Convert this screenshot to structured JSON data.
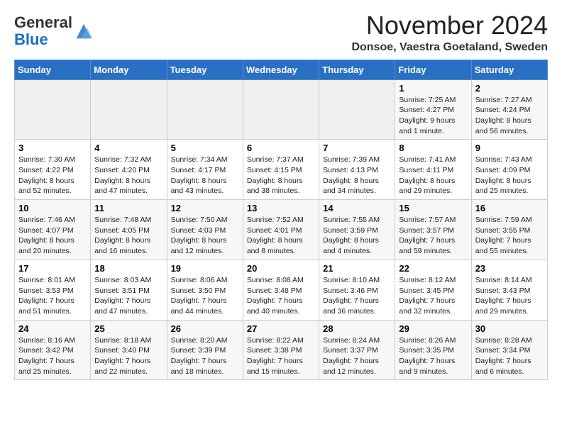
{
  "logo": {
    "general": "General",
    "blue": "Blue"
  },
  "header": {
    "month": "November 2024",
    "location": "Donsoe, Vaestra Goetaland, Sweden"
  },
  "weekdays": [
    "Sunday",
    "Monday",
    "Tuesday",
    "Wednesday",
    "Thursday",
    "Friday",
    "Saturday"
  ],
  "weeks": [
    [
      {
        "day": "",
        "info": ""
      },
      {
        "day": "",
        "info": ""
      },
      {
        "day": "",
        "info": ""
      },
      {
        "day": "",
        "info": ""
      },
      {
        "day": "",
        "info": ""
      },
      {
        "day": "1",
        "info": "Sunrise: 7:25 AM\nSunset: 4:27 PM\nDaylight: 9 hours and 1 minute."
      },
      {
        "day": "2",
        "info": "Sunrise: 7:27 AM\nSunset: 4:24 PM\nDaylight: 8 hours and 56 minutes."
      }
    ],
    [
      {
        "day": "3",
        "info": "Sunrise: 7:30 AM\nSunset: 4:22 PM\nDaylight: 8 hours and 52 minutes."
      },
      {
        "day": "4",
        "info": "Sunrise: 7:32 AM\nSunset: 4:20 PM\nDaylight: 8 hours and 47 minutes."
      },
      {
        "day": "5",
        "info": "Sunrise: 7:34 AM\nSunset: 4:17 PM\nDaylight: 8 hours and 43 minutes."
      },
      {
        "day": "6",
        "info": "Sunrise: 7:37 AM\nSunset: 4:15 PM\nDaylight: 8 hours and 38 minutes."
      },
      {
        "day": "7",
        "info": "Sunrise: 7:39 AM\nSunset: 4:13 PM\nDaylight: 8 hours and 34 minutes."
      },
      {
        "day": "8",
        "info": "Sunrise: 7:41 AM\nSunset: 4:11 PM\nDaylight: 8 hours and 29 minutes."
      },
      {
        "day": "9",
        "info": "Sunrise: 7:43 AM\nSunset: 4:09 PM\nDaylight: 8 hours and 25 minutes."
      }
    ],
    [
      {
        "day": "10",
        "info": "Sunrise: 7:46 AM\nSunset: 4:07 PM\nDaylight: 8 hours and 20 minutes."
      },
      {
        "day": "11",
        "info": "Sunrise: 7:48 AM\nSunset: 4:05 PM\nDaylight: 8 hours and 16 minutes."
      },
      {
        "day": "12",
        "info": "Sunrise: 7:50 AM\nSunset: 4:03 PM\nDaylight: 8 hours and 12 minutes."
      },
      {
        "day": "13",
        "info": "Sunrise: 7:52 AM\nSunset: 4:01 PM\nDaylight: 8 hours and 8 minutes."
      },
      {
        "day": "14",
        "info": "Sunrise: 7:55 AM\nSunset: 3:59 PM\nDaylight: 8 hours and 4 minutes."
      },
      {
        "day": "15",
        "info": "Sunrise: 7:57 AM\nSunset: 3:57 PM\nDaylight: 7 hours and 59 minutes."
      },
      {
        "day": "16",
        "info": "Sunrise: 7:59 AM\nSunset: 3:55 PM\nDaylight: 7 hours and 55 minutes."
      }
    ],
    [
      {
        "day": "17",
        "info": "Sunrise: 8:01 AM\nSunset: 3:53 PM\nDaylight: 7 hours and 51 minutes."
      },
      {
        "day": "18",
        "info": "Sunrise: 8:03 AM\nSunset: 3:51 PM\nDaylight: 7 hours and 47 minutes."
      },
      {
        "day": "19",
        "info": "Sunrise: 8:06 AM\nSunset: 3:50 PM\nDaylight: 7 hours and 44 minutes."
      },
      {
        "day": "20",
        "info": "Sunrise: 8:08 AM\nSunset: 3:48 PM\nDaylight: 7 hours and 40 minutes."
      },
      {
        "day": "21",
        "info": "Sunrise: 8:10 AM\nSunset: 3:46 PM\nDaylight: 7 hours and 36 minutes."
      },
      {
        "day": "22",
        "info": "Sunrise: 8:12 AM\nSunset: 3:45 PM\nDaylight: 7 hours and 32 minutes."
      },
      {
        "day": "23",
        "info": "Sunrise: 8:14 AM\nSunset: 3:43 PM\nDaylight: 7 hours and 29 minutes."
      }
    ],
    [
      {
        "day": "24",
        "info": "Sunrise: 8:16 AM\nSunset: 3:42 PM\nDaylight: 7 hours and 25 minutes."
      },
      {
        "day": "25",
        "info": "Sunrise: 8:18 AM\nSunset: 3:40 PM\nDaylight: 7 hours and 22 minutes."
      },
      {
        "day": "26",
        "info": "Sunrise: 8:20 AM\nSunset: 3:39 PM\nDaylight: 7 hours and 18 minutes."
      },
      {
        "day": "27",
        "info": "Sunrise: 8:22 AM\nSunset: 3:38 PM\nDaylight: 7 hours and 15 minutes."
      },
      {
        "day": "28",
        "info": "Sunrise: 8:24 AM\nSunset: 3:37 PM\nDaylight: 7 hours and 12 minutes."
      },
      {
        "day": "29",
        "info": "Sunrise: 8:26 AM\nSunset: 3:35 PM\nDaylight: 7 hours and 9 minutes."
      },
      {
        "day": "30",
        "info": "Sunrise: 8:28 AM\nSunset: 3:34 PM\nDaylight: 7 hours and 6 minutes."
      }
    ]
  ]
}
